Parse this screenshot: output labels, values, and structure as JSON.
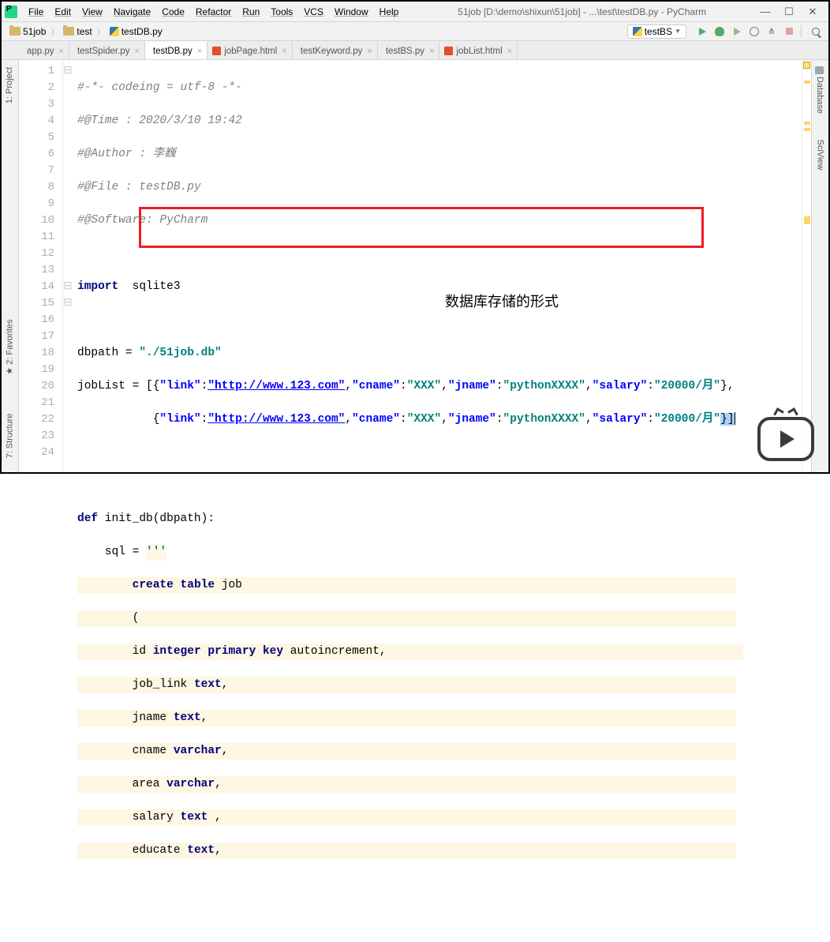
{
  "titlebar": {
    "menus": [
      "File",
      "Edit",
      "View",
      "Navigate",
      "Code",
      "Refactor",
      "Run",
      "Tools",
      "VCS",
      "Window",
      "Help"
    ],
    "title": "51job [D:\\demo\\shixun\\51job] - ...\\test\\testDB.py - PyCharm"
  },
  "breadcrumbs": {
    "project": "51job",
    "folder": "test",
    "file": "testDB.py"
  },
  "run_config": {
    "name": "testBS"
  },
  "tabs": [
    {
      "name": "app.py",
      "type": "py",
      "active": false
    },
    {
      "name": "testSpider.py",
      "type": "py",
      "active": false
    },
    {
      "name": "testDB.py",
      "type": "py",
      "active": true
    },
    {
      "name": "jobPage.html",
      "type": "html",
      "active": false
    },
    {
      "name": "testKeyword.py",
      "type": "py",
      "active": false
    },
    {
      "name": "testBS.py",
      "type": "py",
      "active": false
    },
    {
      "name": "jobList.html",
      "type": "html",
      "active": false
    }
  ],
  "left_tools": [
    {
      "label": "1: Project"
    },
    {
      "label": "2: Favorites"
    },
    {
      "label": "7: Structure"
    }
  ],
  "right_tools": [
    {
      "label": "Database"
    },
    {
      "label": "SciView"
    }
  ],
  "code": {
    "line1": "#-*- codeing = utf-8 -*-",
    "line2": "#@Time : 2020/3/10 19:42",
    "line3": "#@Author : 李巍",
    "line4": "#@File : testDB.py",
    "line5": "#@Software: PyCharm",
    "line7_import": "import",
    "line7_mod": "  sqlite3",
    "line9_var": "dbpath = ",
    "line9_val": "\"./51job.db\"",
    "line10_var": "jobList = ",
    "line10_json_open": "[{",
    "j_link_k": "\"link\"",
    "j_link_v": "\"http://www.123.com\"",
    "j_cname_k": "\"cname\"",
    "j_cname_v": "\"XXX\"",
    "j_jname_k": "\"jname\"",
    "j_jname_v": "\"pythonXXXX\"",
    "j_salary_k": "\"salary\"",
    "j_salary_v": "\"20000/月\"",
    "line10_end": "},",
    "line11_lead": "           {",
    "line11_end": "}]",
    "line14_def": "def",
    "line14_fn": " init_db(dbpath):",
    "line15_lead": "    sql = ",
    "line15_q": "'''",
    "line16": "        create table job",
    "line17": "        (",
    "line18": "        id integer primary key autoincrement,",
    "line19": "        job_link text,",
    "line20": "        jname text,",
    "line21": "        cname varchar,",
    "line22": "        area varchar,",
    "line23": "        salary text ,",
    "line24": "        educate text,",
    "sql": {
      "create": "create table",
      "job": "job",
      "id": "id",
      "integer": "integer",
      "pk": "primary key",
      "ai": "autoincrement",
      "joblink": "job_link",
      "text": "text",
      "jname": "jname",
      "cname": "cname",
      "varchar": "varchar",
      "area": "area",
      "salary": "salary",
      "educate": "educate"
    }
  },
  "annotation": "数据库存储的形式"
}
